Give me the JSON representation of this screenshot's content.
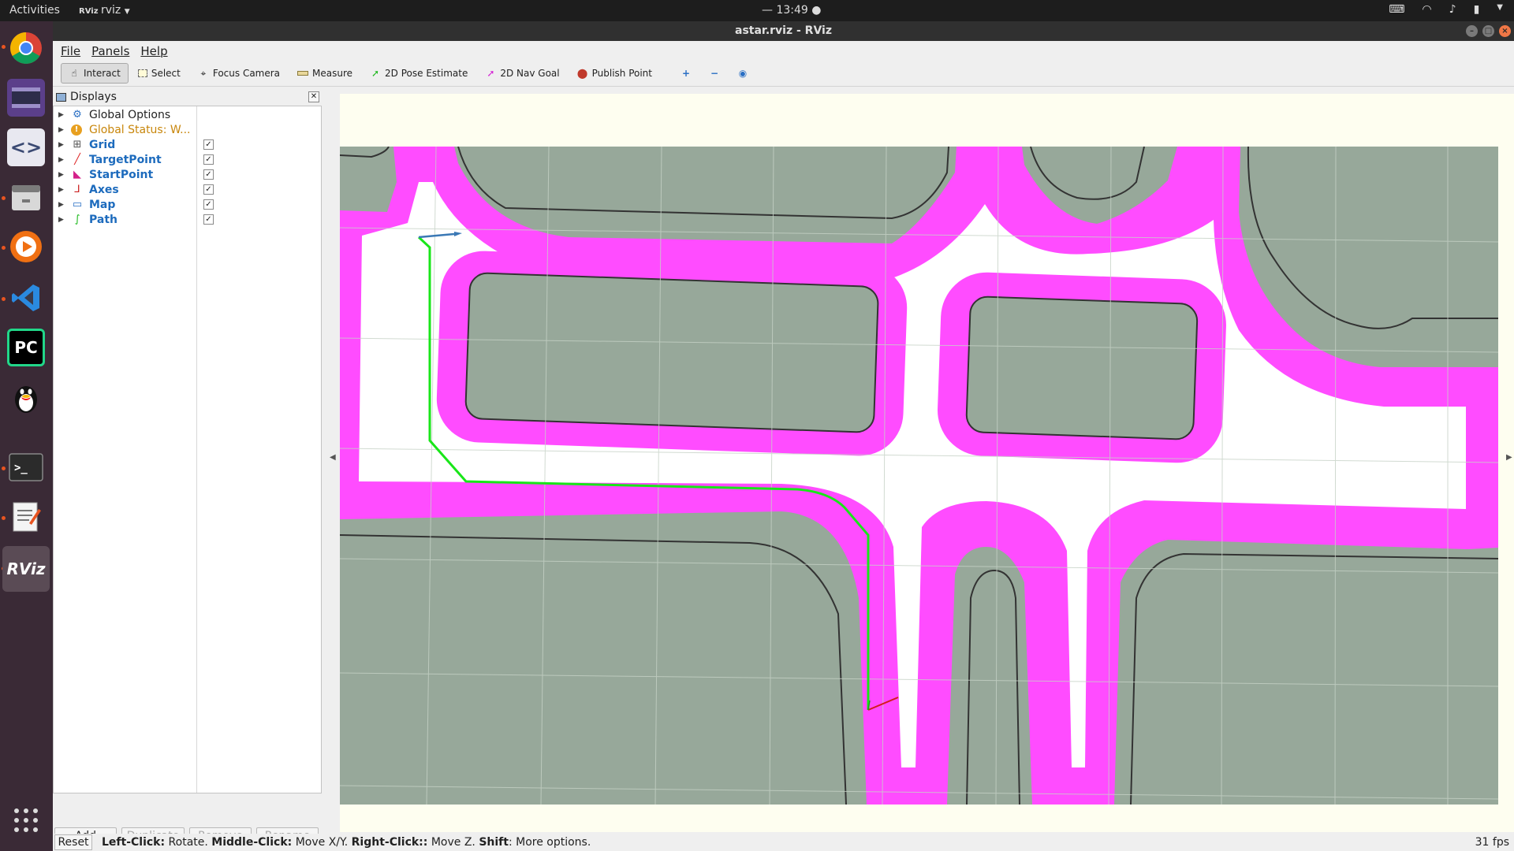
{
  "topbar": {
    "activities": "Activities",
    "app_menu": "rviz",
    "clock": "— 13:49 ●"
  },
  "dock": {
    "items": [
      {
        "name": "chrome-icon",
        "color": "#4285f4"
      },
      {
        "name": "video-icon",
        "color": "#6b4e9b"
      },
      {
        "name": "code-editor-icon",
        "color": "#4a5a80"
      },
      {
        "name": "files-icon",
        "color": "#b05a3a"
      },
      {
        "name": "media-player-icon",
        "color": "#e9611a"
      },
      {
        "name": "vscode-icon",
        "color": "#2a78c7"
      },
      {
        "name": "pycharm-icon",
        "color": "#21d789"
      },
      {
        "name": "qq-icon",
        "color": "#111111"
      },
      {
        "name": "terminal-icon",
        "color": "#2b2b2b"
      },
      {
        "name": "text-editor-icon",
        "color": "#e3e3e3"
      },
      {
        "name": "rviz-icon",
        "color": "#4d4a4a"
      }
    ],
    "rviz_label": "RViz",
    "pycharm_label": "PC"
  },
  "window": {
    "title": "astar.rviz - RViz"
  },
  "menu": {
    "file": "File",
    "panels": "Panels",
    "help": "Help"
  },
  "toolbar": {
    "interact": "Interact",
    "select": "Select",
    "focus_camera": "Focus Camera",
    "measure": "Measure",
    "pose_estimate": "2D Pose Estimate",
    "nav_goal": "2D Nav Goal",
    "publish_point": "Publish Point"
  },
  "displays": {
    "title": "Displays",
    "items": [
      {
        "label": "Global Options",
        "style": "plain",
        "checked": null
      },
      {
        "label": "Global Status: W...",
        "style": "warn",
        "checked": null
      },
      {
        "label": "Grid",
        "style": "blue",
        "checked": "✓"
      },
      {
        "label": "TargetPoint",
        "style": "blue",
        "checked": "✓"
      },
      {
        "label": "StartPoint",
        "style": "blue",
        "checked": "✓"
      },
      {
        "label": "Axes",
        "style": "blue",
        "checked": "✓"
      },
      {
        "label": "Map",
        "style": "blue",
        "checked": "✓"
      },
      {
        "label": "Path",
        "style": "blue",
        "checked": "✓"
      }
    ]
  },
  "panel_buttons": {
    "add": "Add",
    "duplicate": "Duplicate",
    "remove": "Remove",
    "rename": "Rename"
  },
  "status": {
    "reset": "Reset",
    "help_1": "Left-Click:",
    "help_2": " Rotate. ",
    "help_3": "Middle-Click:",
    "help_4": " Move X/Y. ",
    "help_5": "Right-Click::",
    "help_6": " Move Z. ",
    "help_7": "Shift",
    "help_8": ": More options.",
    "fps": "31 fps"
  },
  "colors": {
    "map_background": "#fefef0",
    "obstacle": "#97a89a",
    "inflation": "#ff4cff",
    "free": "#ffffff",
    "path": "#19e619",
    "grid": "#c8d4c8"
  }
}
